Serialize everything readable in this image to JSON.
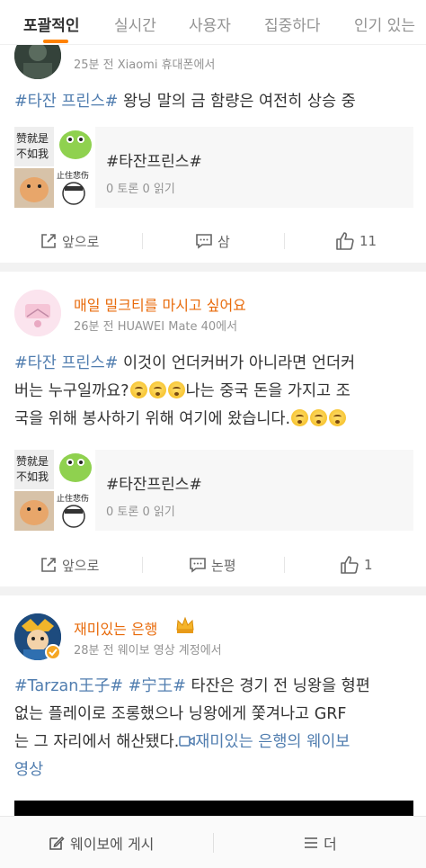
{
  "tabs": [
    {
      "label": "포괄적인",
      "active": true
    },
    {
      "label": "실시간",
      "active": false
    },
    {
      "label": "사용자",
      "active": false
    },
    {
      "label": "집중하다",
      "active": false
    },
    {
      "label": "인기 있는",
      "active": false
    }
  ],
  "accent_color": "#ff8200",
  "username_color": "#e86b0c",
  "hashtag_color": "#507daf",
  "posts": [
    {
      "username": "",
      "meta": "25분 전 Xiaomi 휴대폰에서",
      "text_parts": [
        {
          "text": "#타잔 프린스#",
          "hashtag": true
        },
        {
          "text": " 왕닝 말의 금 함량은 여전히 상승 중",
          "hashtag": false
        }
      ],
      "topic": {
        "title": "#타잔프린스#",
        "stats": "0 토론 0 읽기",
        "thumb_text_1": "赞就是",
        "thumb_text_2": "不如我",
        "thumb_text_3": "止住悲伤"
      },
      "actions": {
        "share": "앞으로",
        "comment": "삼",
        "like": "11"
      }
    },
    {
      "username": "매일 밀크티를 마시고 싶어요",
      "meta": "26분 전 HUAWEI Mate 40에서",
      "line1_prefix": "#타잔 프린스#",
      "line1_rest": " 이것이 언더커버가 아니라면 언더커",
      "line2": "버는 누구일까요?",
      "line2_rest": "나는 중국 돈을 가지고 조",
      "line3": "국을 위해 봉사하기 위해 여기에 왔습니다.",
      "topic": {
        "title": "#타잔프린스#",
        "stats": "0 토론 0 읽기",
        "thumb_text_1": "赞就是",
        "thumb_text_2": "不如我",
        "thumb_text_3": "止住悲伤"
      },
      "actions": {
        "share": "앞으로",
        "comment": "논평",
        "like": "1"
      }
    },
    {
      "username": "재미있는 은행",
      "meta": "28분 전 웨이보 영상 계정에서",
      "line1_tag1": "#Tarzan王子#",
      "line1_tag2": "#宁王#",
      "line1_rest": " 타잔은 경기 전 닝왕을 형편",
      "line2": "없는 플레이로 조롱했으나 닝왕에게 쫓겨나고 GRF",
      "line3": "는 그 자리에서 해산됐다.",
      "video_link": "재미있는 은행의 웨이보",
      "line4": "영상"
    }
  ],
  "bottom_bar": {
    "post_label": "웨이보에 게시",
    "more_label": "더"
  }
}
